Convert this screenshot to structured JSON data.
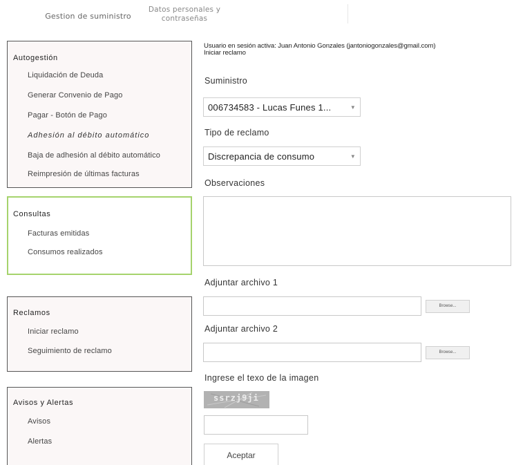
{
  "tabs": {
    "suministro": "Gestion de suministro",
    "personales_line1": "Datos personales y",
    "personales_line2": "contraseñas"
  },
  "sidebar": {
    "autogestion": {
      "title": "Autogestión",
      "items": [
        "Liquidación de Deuda",
        "Generar Convenio de Pago",
        "Pagar - Botón de Pago",
        "Adhesión al débito automático",
        "Baja de adhesión al débito automático",
        "Reimpresión de últimas facturas"
      ]
    },
    "consultas": {
      "title": "Consultas",
      "items": [
        "Facturas emitidas",
        "Consumos realizados"
      ]
    },
    "reclamos": {
      "title": "Reclamos",
      "items": [
        "Iniciar reclamo",
        "Seguimiento de reclamo"
      ]
    },
    "avisos": {
      "title": "Avisos y Alertas",
      "items": [
        "Avisos",
        "Alertas"
      ]
    }
  },
  "form": {
    "session_text": "Usuario en sesión activa: Juan Antonio Gonzales (jantoniogonzales@gmail.com)",
    "page_heading": "Iniciar reclamo",
    "suministro_label": "Suministro",
    "suministro_value": "006734583 - Lucas Funes 1...",
    "tipo_label": "Tipo de reclamo",
    "tipo_value": "Discrepancia de consumo",
    "observaciones_label": "Observaciones",
    "adjunto1_label": "Adjuntar archivo 1",
    "adjunto2_label": "Adjuntar archivo 2",
    "browse_label": "Browse...",
    "captcha_label": "Ingrese el texo de la imagen",
    "captcha_text": "ssrzj9ji",
    "accept_label": "Aceptar"
  },
  "colors": {
    "consultas_border": "#a5d36c",
    "panel_bg": "#fbf7f7"
  }
}
